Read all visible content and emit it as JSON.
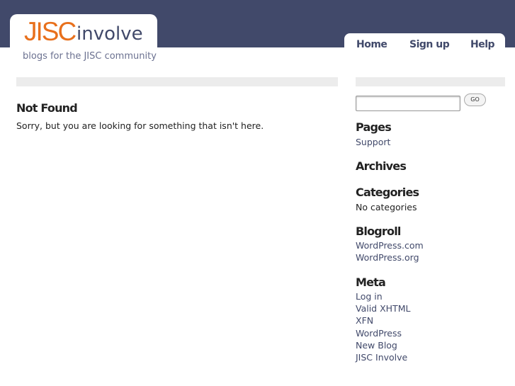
{
  "header": {
    "logo_brand": "JISC",
    "logo_word": "involve",
    "tagline": "blogs for the JISC community",
    "colors": {
      "bar": "#41496a",
      "brand_orange": "#e8701c"
    }
  },
  "nav": {
    "items": [
      {
        "label": "Home"
      },
      {
        "label": "Sign up"
      },
      {
        "label": "Help"
      }
    ]
  },
  "main": {
    "title": "Not Found",
    "message": "Sorry, but you are looking for something that isn't here."
  },
  "sidebar": {
    "search": {
      "value": "",
      "button_label": "GO"
    },
    "pages": {
      "heading": "Pages",
      "links": [
        "Support"
      ]
    },
    "archives": {
      "heading": "Archives"
    },
    "categories": {
      "heading": "Categories",
      "text": "No categories"
    },
    "blogroll": {
      "heading": "Blogroll",
      "links": [
        "WordPress.com",
        "WordPress.org"
      ]
    },
    "meta": {
      "heading": "Meta",
      "links": [
        "Log in",
        "Valid XHTML",
        "XFN",
        "WordPress",
        "New Blog",
        "JISC Involve"
      ]
    }
  }
}
